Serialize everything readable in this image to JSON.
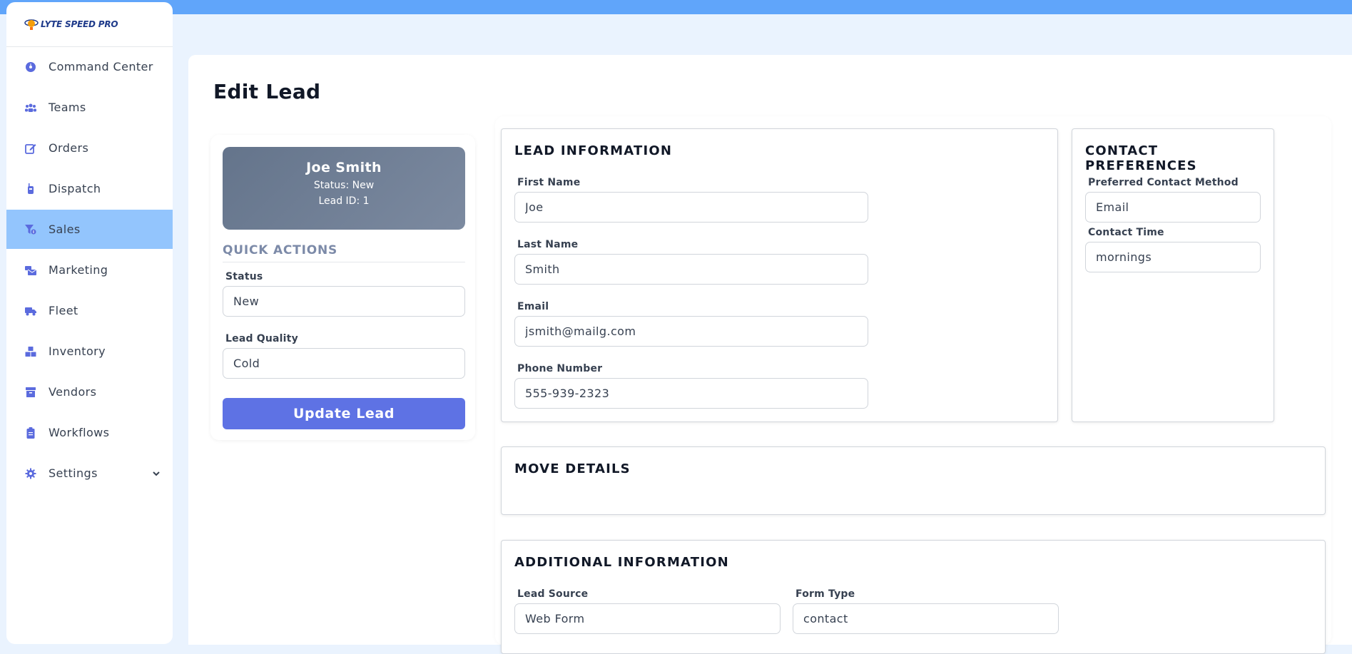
{
  "app": {
    "brand": "LYTE SPEED PRO"
  },
  "sidebar": {
    "items": [
      {
        "label": "Command Center",
        "icon": "gauge-icon"
      },
      {
        "label": "Teams",
        "icon": "users-icon"
      },
      {
        "label": "Orders",
        "icon": "edit-icon"
      },
      {
        "label": "Dispatch",
        "icon": "walkie-talkie-icon"
      },
      {
        "label": "Sales",
        "icon": "funnel-dollar-icon",
        "active": true
      },
      {
        "label": "Marketing",
        "icon": "mail-bulk-icon"
      },
      {
        "label": "Fleet",
        "icon": "truck-icon"
      },
      {
        "label": "Inventory",
        "icon": "boxes-icon"
      },
      {
        "label": "Vendors",
        "icon": "archive-icon"
      },
      {
        "label": "Workflows",
        "icon": "clipboard-icon"
      },
      {
        "label": "Settings",
        "icon": "gear-icon"
      }
    ]
  },
  "page": {
    "title": "Edit Lead"
  },
  "lead": {
    "name": "Joe Smith",
    "status_line": "Status: New",
    "id_line": "Lead ID: 1"
  },
  "quick_actions": {
    "title": "QUICK ACTIONS",
    "status_label": "Status",
    "status_value": "New",
    "quality_label": "Lead Quality",
    "quality_value": "Cold",
    "update_button": "Update Lead"
  },
  "lead_info": {
    "title": "LEAD INFORMATION",
    "first_name_label": "First Name",
    "first_name": "Joe",
    "last_name_label": "Last Name",
    "last_name": "Smith",
    "email_label": "Email",
    "email": "jsmith@mailg.com",
    "phone_label": "Phone Number",
    "phone": "555-939-2323"
  },
  "contact_prefs": {
    "title": "CONTACT PREFERENCES",
    "method_label": "Preferred Contact Method",
    "method": "Email",
    "time_label": "Contact Time",
    "time": "mornings"
  },
  "move_details": {
    "title": "MOVE DETAILS"
  },
  "additional_info": {
    "title": "ADDITIONAL INFORMATION",
    "source_label": "Lead Source",
    "source": "Web Form",
    "form_type_label": "Form Type",
    "form_type": "contact"
  },
  "colors": {
    "topbar": "#60a5fa",
    "active_nav": "#93c5fd",
    "button": "#5e72e4",
    "icon": "#5b6bde"
  }
}
